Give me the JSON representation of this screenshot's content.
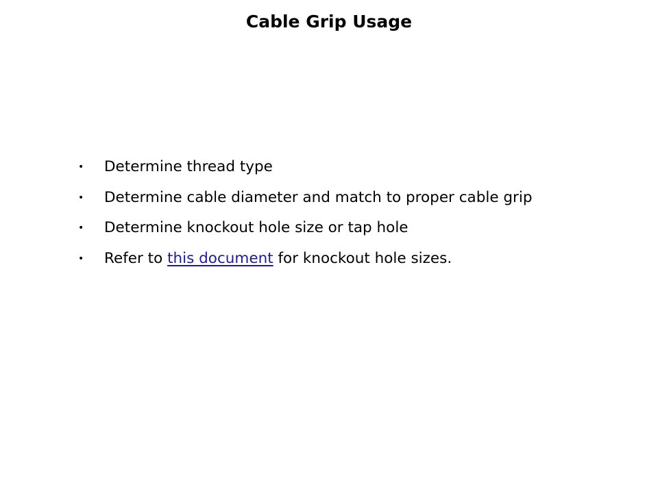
{
  "slide": {
    "title": "Cable Grip Usage",
    "bullet_marker": "•",
    "bullets": [
      {
        "text": "Determine thread type"
      },
      {
        "text": "Determine cable diameter and match to proper cable grip"
      },
      {
        "text": "Determine knockout hole size or tap hole"
      },
      {
        "prefix": "Refer to ",
        "link_text": "this document",
        "suffix": " for knockout hole sizes."
      }
    ],
    "colors": {
      "link": "#1a1aa6",
      "text": "#000000",
      "background": "#ffffff"
    }
  }
}
